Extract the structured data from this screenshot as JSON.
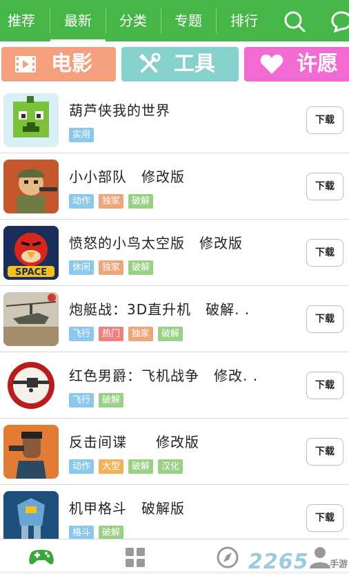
{
  "nav": {
    "tabs": [
      "推荐",
      "最新",
      "分类",
      "专题",
      "排行"
    ],
    "active_tab": "最新",
    "icons": [
      "search-icon",
      "chat-bubble-icon"
    ],
    "color": "#47b649"
  },
  "categories": [
    {
      "label": "电影",
      "icon": "film-icon",
      "color": "#f4a07e"
    },
    {
      "label": "工具",
      "icon": "tools-icon",
      "color": "#86d1cc"
    },
    {
      "label": "许愿",
      "icon": "heart-icon",
      "color": "#f26bd2"
    }
  ],
  "download_label": "下载",
  "apps": [
    {
      "name": "葫芦侠我的世界",
      "tags": [
        "实用"
      ],
      "icon": "green-creeper-app-icon"
    },
    {
      "name": "小小部队　修改版",
      "tags": [
        "动作",
        "独家",
        "破解"
      ],
      "icon": "soldier-app-icon"
    },
    {
      "name": "愤怒的小鸟太空版　修改版",
      "tags": [
        "休闲",
        "独家",
        "破解"
      ],
      "icon": "angry-bird-space-app-icon"
    },
    {
      "name": "炮艇战：3D直升机　破解. .",
      "tags": [
        "飞行",
        "热门",
        "独家",
        "破解"
      ],
      "icon": "helicopter-app-icon"
    },
    {
      "name": "红色男爵：飞机战争　修改. .",
      "tags": [
        "飞行",
        "破解"
      ],
      "icon": "red-baron-app-icon"
    },
    {
      "name": "反击间谍　　修改版",
      "tags": [
        "动作",
        "大型",
        "破解",
        "汉化"
      ],
      "icon": "spy-app-icon"
    },
    {
      "name": "机甲格斗　破解版",
      "tags": [
        "格斗",
        "破解"
      ],
      "icon": "mech-app-icon"
    }
  ],
  "tag_colors": {
    "实用": "#8cc8ec",
    "动作": "#8cc8ec",
    "休闲": "#8cc8ec",
    "飞行": "#8cc8ec",
    "格斗": "#8cc8ec",
    "独家": "#f0a47a",
    "大型": "#f3b25a",
    "热门": "#f08080",
    "破解": "#9acf86",
    "汉化": "#9acf86"
  },
  "bottom_nav": [
    "gamepad-icon",
    "apps-grid-icon",
    "compass-icon",
    "user-icon"
  ],
  "watermark": {
    "text": "2265",
    "sub": "手游"
  }
}
